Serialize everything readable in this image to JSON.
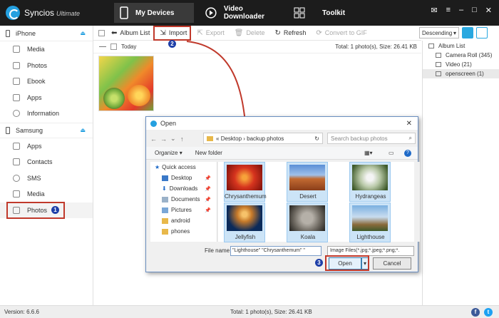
{
  "app": {
    "name": "Syncios",
    "edition": "Ultimate",
    "version": "Version: 6.6.6"
  },
  "top_tabs": [
    {
      "label": "My Devices"
    },
    {
      "label": "Video Downloader"
    },
    {
      "label": "Toolkit"
    }
  ],
  "sidebar": {
    "iphone": {
      "label": "iPhone",
      "items": [
        {
          "label": "Media"
        },
        {
          "label": "Photos"
        },
        {
          "label": "Ebook"
        },
        {
          "label": "Apps"
        },
        {
          "label": "Information"
        }
      ]
    },
    "samsung": {
      "label": "Samsung",
      "items": [
        {
          "label": "Apps"
        },
        {
          "label": "Contacts"
        },
        {
          "label": "SMS"
        },
        {
          "label": "Media"
        },
        {
          "label": "Photos"
        }
      ]
    }
  },
  "toolbar": {
    "album_list": "Album List",
    "import": "Import",
    "export": "Export",
    "delete": "Delete",
    "refresh": "Refresh",
    "convert": "Convert to GIF",
    "sort": "Descending"
  },
  "content": {
    "group": "Today",
    "total": "Total: 1 photo(s), Size: 26.41 KB"
  },
  "album_panel": {
    "title": "Album List",
    "items": [
      {
        "label": "Camera Roll (345)"
      },
      {
        "label": "Video (21)"
      },
      {
        "label": "openscreen (1)"
      }
    ]
  },
  "status": {
    "total": "Total: 1 photo(s), Size: 26.41 KB"
  },
  "badges": {
    "one": "1",
    "two": "2",
    "three": "3"
  },
  "dialog": {
    "title": "Open",
    "path": {
      "prefix": "«",
      "parts": [
        "Desktop",
        "backup photos"
      ]
    },
    "search_placeholder": "Search backup photos",
    "organize": "Organize",
    "new_folder": "New folder",
    "tree": [
      {
        "label": "Quick access"
      },
      {
        "label": "Desktop"
      },
      {
        "label": "Downloads"
      },
      {
        "label": "Documents"
      },
      {
        "label": "Pictures"
      },
      {
        "label": "android"
      },
      {
        "label": "phones"
      }
    ],
    "files": [
      {
        "label": "Chrysanthemum"
      },
      {
        "label": "Desert"
      },
      {
        "label": "Hydrangeas"
      },
      {
        "label": "Jellyfish"
      },
      {
        "label": "Koala"
      },
      {
        "label": "Lighthouse"
      }
    ],
    "filename_label": "File name:",
    "filename_value": "\"Lighthouse\" \"Chrysanthemum\" \"",
    "filetype": "Image Files(*.jpg;*.jpeg;*.png;*.",
    "open": "Open",
    "cancel": "Cancel"
  },
  "colors": {
    "accent": "#29a8e0",
    "highlight": "#c0392b",
    "badge": "#1e3fa8",
    "titlebar": "#1c1c1c"
  }
}
